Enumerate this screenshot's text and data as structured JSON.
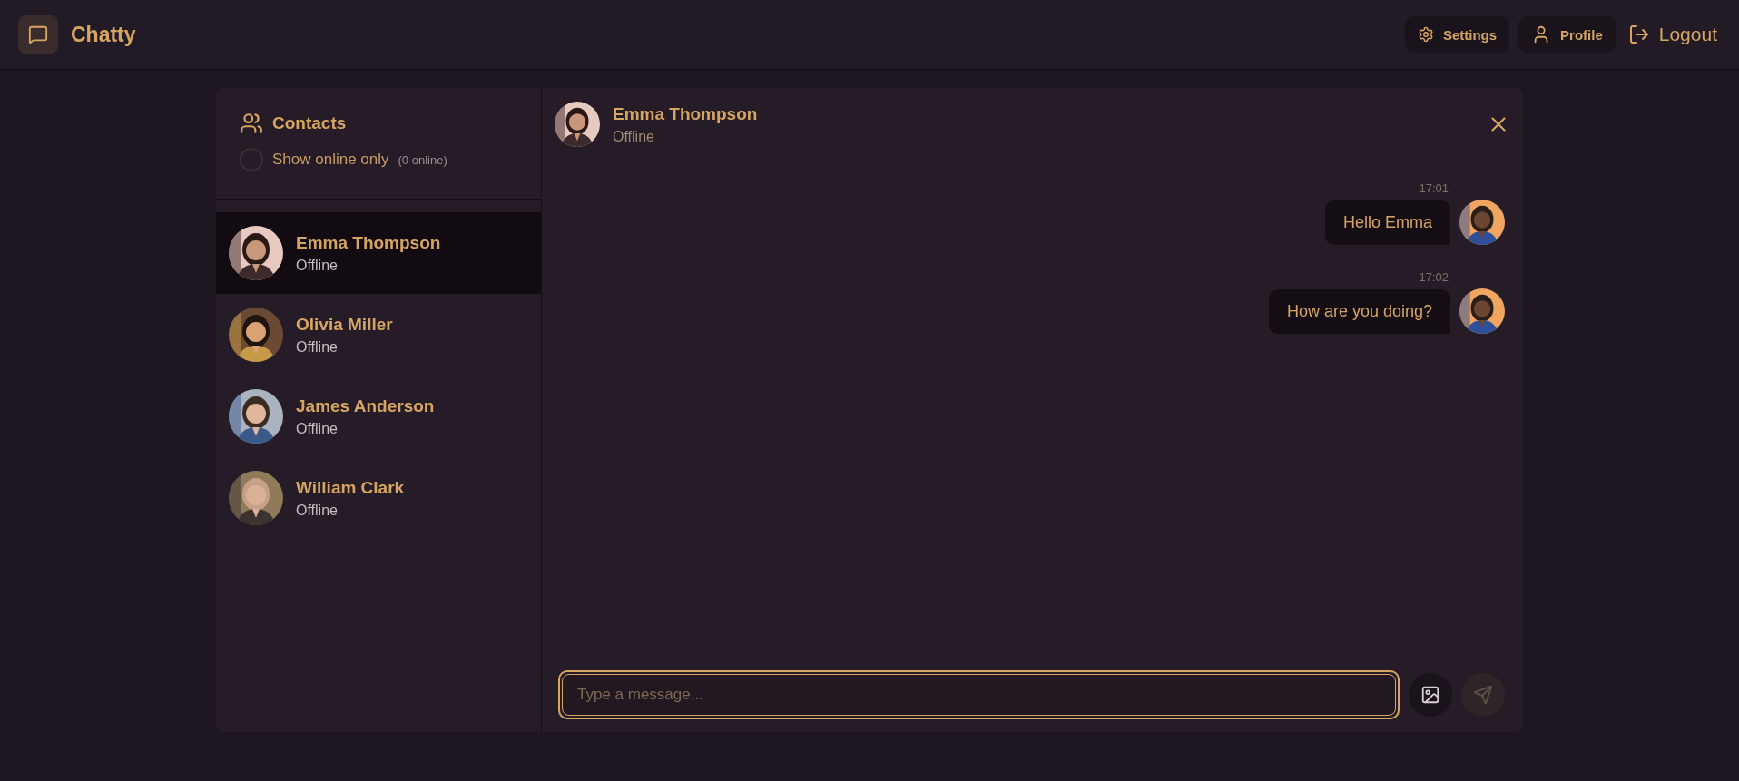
{
  "app": {
    "title": "Chatty"
  },
  "nav": [
    {
      "kind": "settings",
      "label": "Settings"
    },
    {
      "kind": "profile",
      "label": "Profile"
    },
    {
      "kind": "logout",
      "label": "Logout"
    }
  ],
  "sidebar": {
    "title": "Contacts",
    "filter": {
      "label": "Show online only",
      "checked": false,
      "count": "(0 online)"
    },
    "contacts": [
      {
        "name": "Emma Thompson",
        "status": "Offline",
        "selected": true
      },
      {
        "name": "Olivia Miller",
        "status": "Offline",
        "selected": false
      },
      {
        "name": "James Anderson",
        "status": "Offline",
        "selected": false
      },
      {
        "name": "William Clark",
        "status": "Offline",
        "selected": false
      }
    ]
  },
  "chat": {
    "name": "Emma Thompson",
    "status": "Offline",
    "messages": [
      {
        "time": "17:01",
        "text": "Hello Emma"
      },
      {
        "time": "17:02",
        "text": "How are you doing?"
      }
    ],
    "composer": {
      "placeholder": "Type a message...",
      "send_disabled": true
    }
  }
}
